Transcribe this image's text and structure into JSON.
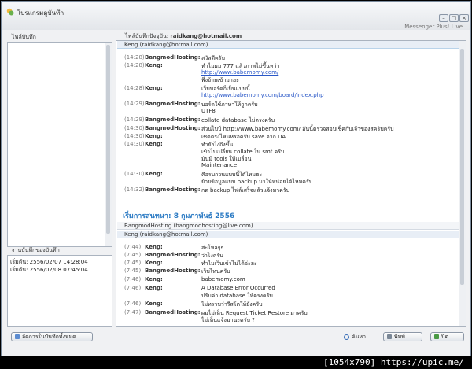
{
  "window": {
    "title": "โปรแกรมดูบันทึก",
    "brand": "Messenger Plus! Live"
  },
  "window_controls": {
    "minimize": "–",
    "maximize": "□",
    "close": "×"
  },
  "left_panel": {
    "files_label": "ไฟล์บันทึก",
    "history_label": "งานบันทึกของบันทึก",
    "history_items": [
      "เริ่มต้น: 2556/02/07 14:28:04",
      "เริ่มต้น: 2556/02/08 07:45:04"
    ]
  },
  "right_panel": {
    "prefix": "ไฟล์บันทึกปัจจุบัน:",
    "account": "raidkang@hotmail.com"
  },
  "session1": {
    "participant": "Keng (raidkang@hotmail.com)",
    "messages": [
      {
        "time": "(14:28)",
        "name": "BangmodHosting:",
        "lines": [
          "สวัสดีครับ"
        ]
      },
      {
        "time": "(14:28)",
        "name": "Keng:",
        "lines": [
          "ทำไมผม 777 แล้วภาพไม่ขึ้นหว่า",
          "http://www.babemomy.com/",
          "พึ่งย้ายเข้ามาฮะ"
        ]
      },
      {
        "time": "(14:28)",
        "name": "Keng:",
        "lines": [
          "เว็บบอร์ดก็เป็นแบบนี้",
          "http://www.babemomy.com/board/index.php"
        ]
      },
      {
        "time": "(14:29)",
        "name": "BangmodHosting:",
        "lines": [
          "บอร์ดใช้ภาษาให้ถูกครับ",
          "UTF8"
        ]
      },
      {
        "time": "(14:29)",
        "name": "BangmodHosting:",
        "lines": [
          "collate database ไม่ตรงครับ"
        ]
      },
      {
        "time": "(14:30)",
        "name": "BangmodHosting:",
        "lines": [
          "ส่วนไปป์ http://www.babemomy.com/ อันนี้ตรวจสอบเช็คกับเจ้าของสคริปครับ"
        ]
      },
      {
        "time": "(14:30)",
        "name": "Keng:",
        "lines": [
          "เซตตรงไหนหรอครับ save จาก DA"
        ]
      },
      {
        "time": "(14:30)",
        "name": "Keng:",
        "lines": [
          "ทำยังไงถึงขึ้น",
          "เข้าไปเปลี่ยน collate ใน smf ครับ",
          "มันมี tools ให้เปลี่ยน",
          "Maintenance"
        ]
      },
      {
        "time": "(14:30)",
        "name": "Keng:",
        "lines": [
          "คือรบกวนแบบนี้ได้ไหมฮะ",
          "ย้ายข้อมูลแบบ backup มาให้หน่อยได้ไหมครับ"
        ]
      },
      {
        "time": "(14:32)",
        "name": "BangmodHosting:",
        "lines": [
          "กด backup ไฟล์เสร็จแล้วแจ้งมาครับ"
        ]
      }
    ]
  },
  "session2": {
    "heading": "เริ่มการสนทนา: 8 กุมภาพันธ์ 2556",
    "participant_a": "BangmodHosting (bangmodhosting@live.com)",
    "participant_b": "Keng (raidkang@hotmail.com)",
    "messages": [
      {
        "time": "(7:44)",
        "name": "Keng:",
        "lines": [
          "สะโหลๆๆ"
        ]
      },
      {
        "time": "(7:45)",
        "name": "BangmodHosting:",
        "lines": [
          "ว่าไงครับ"
        ]
      },
      {
        "time": "(7:45)",
        "name": "Keng:",
        "lines": [
          "ทำไมเว็บเข้าไม่ได้อ่ะฮะ"
        ]
      },
      {
        "time": "(7:45)",
        "name": "BangmodHosting:",
        "lines": [
          "เว็บไหนครับ"
        ]
      },
      {
        "time": "(7:46)",
        "name": "Keng:",
        "lines": [
          "babemomy.com"
        ]
      },
      {
        "time": "(7:46)",
        "name": "Keng:",
        "lines": [
          "A Database Error Occurred",
          "ปรับค่า database ให้ตรงครับ"
        ]
      },
      {
        "time": "(7:46)",
        "name": "Keng:",
        "lines": [
          "ไม่ทราบว่ารีสโตให้ยังครับ"
        ]
      },
      {
        "time": "(7:47)",
        "name": "BangmodHosting:",
        "lines": [
          "ผมไม่เห็น Request Ticket Restore มาครับ",
          "ไม่เห็นแจ้งมานะครับ ?"
        ]
      }
    ]
  },
  "bottom": {
    "manage_label": "จัดการในบันทึกทั้งหมด...",
    "find_label": "ค้นหา...",
    "print_label": "พิมพ์",
    "close_label": "ปิด"
  },
  "watermark": "[1054x790] https://upic.me/"
}
